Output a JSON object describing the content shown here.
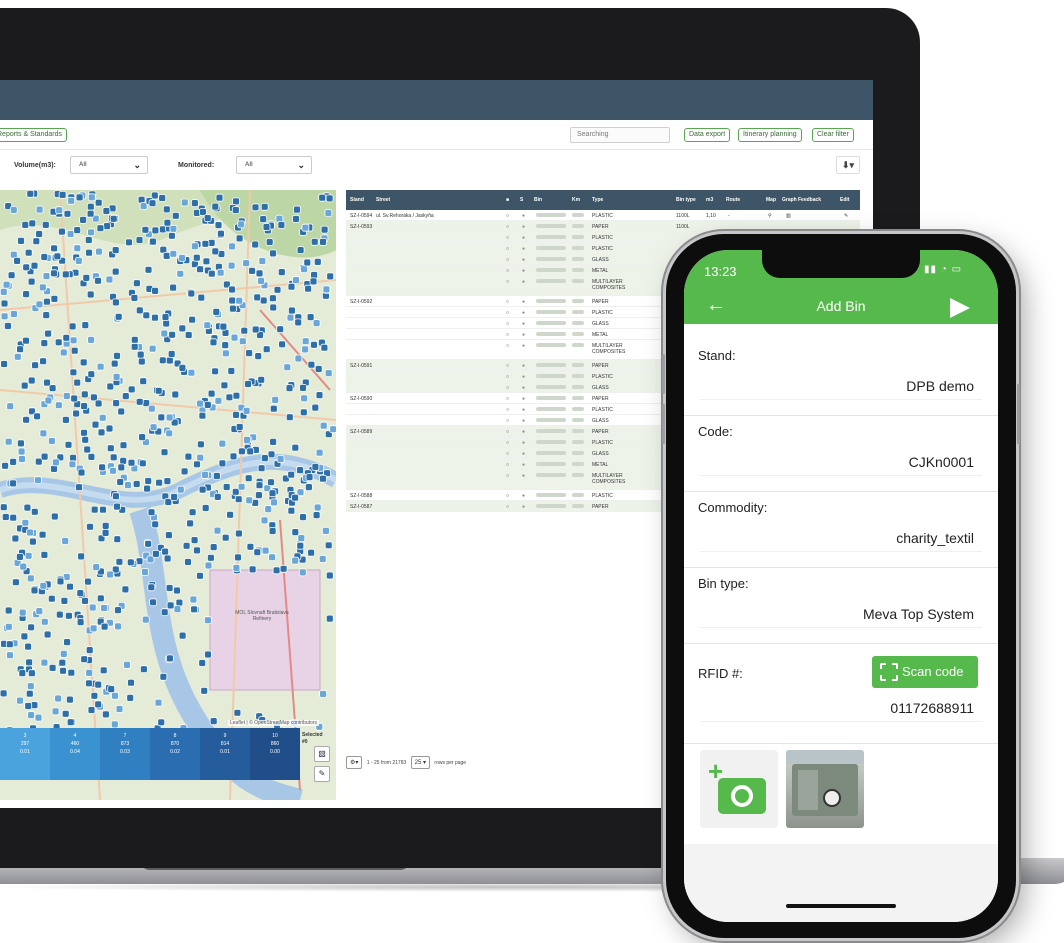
{
  "desktop": {
    "toolbar": {
      "reports_button": "Reports & Standards",
      "search_placeholder": "Searching",
      "data_export_button": "Data export",
      "itinerary_button": "Itinerary planning",
      "clear_filter_button": "Clear filter"
    },
    "filters": {
      "volume_label": "Volume(m3):",
      "volume_value": "All",
      "monitored_label": "Monitored:",
      "monitored_value": "All"
    },
    "map": {
      "attribution": "Leaflet | © OpenStreetMap contributors",
      "district_label": "MOL Slovnaft Bratislava Refinery",
      "legend": [
        {
          "top": "3",
          "mid": "297",
          "bottom": "0.01",
          "color": "#4aa3dd"
        },
        {
          "top": "4",
          "mid": "460",
          "bottom": "0.04",
          "color": "#3a92d0"
        },
        {
          "top": "7",
          "mid": "873",
          "bottom": "0.03",
          "color": "#2f7fc1"
        },
        {
          "top": "8",
          "mid": "870",
          "bottom": "0.02",
          "color": "#2a6db0"
        },
        {
          "top": "9",
          "mid": "814",
          "bottom": "0.01",
          "color": "#245c9c"
        },
        {
          "top": "10",
          "mid": "860",
          "bottom": "0.00",
          "color": "#1f4e88"
        }
      ],
      "selected_label": "Selected",
      "selected_value": "#0"
    },
    "table": {
      "headers": [
        "Stand",
        "Street",
        "■",
        "S",
        "Bin",
        "Km",
        "Type",
        "Bin type",
        "m3",
        "Route",
        "Map",
        "Graph",
        "Feedback",
        "Edit"
      ],
      "rows": [
        {
          "stand": "SZ-I-0594",
          "street": "ul. Sv.Rehoráka / Jaskyňa",
          "type": "PLASTIC",
          "bintype": "1100L",
          "m3": "1,10",
          "route": "-"
        },
        {
          "stand": "SZ-I-0593",
          "street": "",
          "type": "PAPER",
          "bintype": "1100L"
        },
        {
          "stand": "",
          "street": "",
          "type": "PLASTIC"
        },
        {
          "stand": "",
          "street": "",
          "type": "PLASTIC"
        },
        {
          "stand": "",
          "street": "",
          "type": "GLASS"
        },
        {
          "stand": "",
          "street": "",
          "type": "METAL"
        },
        {
          "stand": "",
          "street": "",
          "type": "MULTILAYER COMPOSITES"
        },
        {
          "stand": "SZ-I-0592",
          "street": "",
          "type": "PAPER"
        },
        {
          "stand": "",
          "street": "",
          "type": "PLASTIC"
        },
        {
          "stand": "",
          "street": "",
          "type": "GLASS"
        },
        {
          "stand": "",
          "street": "",
          "type": "METAL"
        },
        {
          "stand": "",
          "street": "",
          "type": "MULTILAYER COMPOSITES"
        },
        {
          "stand": "SZ-I-0591",
          "street": "",
          "type": "PAPER"
        },
        {
          "stand": "",
          "street": "",
          "type": "PLASTIC"
        },
        {
          "stand": "",
          "street": "",
          "type": "GLASS"
        },
        {
          "stand": "SZ-I-0590",
          "street": "",
          "type": "PAPER"
        },
        {
          "stand": "",
          "street": "",
          "type": "PLASTIC"
        },
        {
          "stand": "",
          "street": "",
          "type": "GLASS"
        },
        {
          "stand": "SZ-I-0589",
          "street": "",
          "type": "PAPER"
        },
        {
          "stand": "",
          "street": "",
          "type": "PLASTIC"
        },
        {
          "stand": "",
          "street": "",
          "type": "GLASS"
        },
        {
          "stand": "",
          "street": "",
          "type": "METAL"
        },
        {
          "stand": "",
          "street": "",
          "type": "MULTILAYER COMPOSITES"
        },
        {
          "stand": "SZ-I-0588",
          "street": "",
          "type": "PLASTIC"
        },
        {
          "stand": "SZ-I-0587",
          "street": "",
          "type": "PAPER"
        }
      ]
    },
    "pager": {
      "range": "1 - 25 from 21783",
      "per_page": "25",
      "per_page_label": "rows per page"
    }
  },
  "phone": {
    "status_time": "13:23",
    "title": "Add Bin",
    "fields": [
      {
        "label": "Stand:",
        "value": "DPB demo"
      },
      {
        "label": "Code:",
        "value": "CJKn0001"
      },
      {
        "label": "Commodity:",
        "value": "charity_textil"
      },
      {
        "label": "Bin type:",
        "value": "Meva Top System"
      }
    ],
    "rfid_label": "RFID #:",
    "rfid_value": "01172688911",
    "scan_button": "Scan code"
  },
  "colors": {
    "header": "#3d5566",
    "accent_green": "#56b94b",
    "map_marker": "#2f6fa8"
  }
}
